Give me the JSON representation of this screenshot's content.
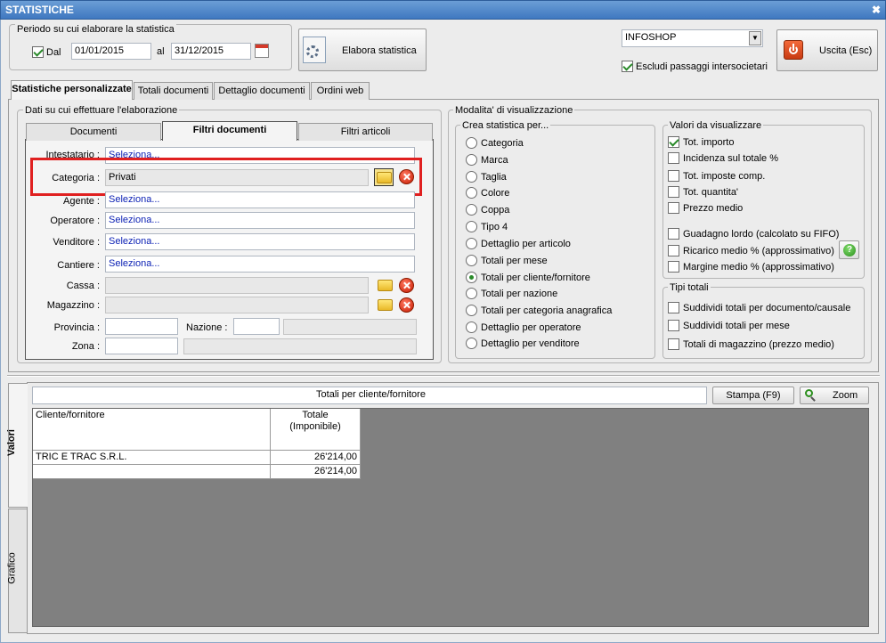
{
  "window": {
    "title": "STATISTICHE",
    "close_glyph": "✖"
  },
  "period": {
    "legend": "Periodo su cui elaborare la statistica",
    "from_checked": true,
    "from_label": "Dal",
    "from_value": "01/01/2015",
    "to_label": "al",
    "to_value": "31/12/2015",
    "calendar_icon": "calendar-icon"
  },
  "elabora_button": {
    "label": "Elabora statistica",
    "icon": "gear-document-icon"
  },
  "company_select": {
    "value": "INFOSHOP"
  },
  "escludi": {
    "checked": true,
    "label": "Escludi passaggi intersocietari"
  },
  "exit_button": {
    "label": "Uscita (Esc)",
    "icon": "power-icon"
  },
  "main_tabs": [
    "Statistiche personalizzate",
    "Totali documenti",
    "Dettaglio documenti",
    "Ordini web"
  ],
  "data_panel": {
    "legend": "Dati su cui effettuare l'elaborazione",
    "tabs": [
      "Documenti",
      "Filtri documenti",
      "Filtri articoli"
    ],
    "active_tab": "Filtri documenti",
    "fields": {
      "intestatario": {
        "label": "Intestatario :",
        "value": "Seleziona..."
      },
      "categoria": {
        "label": "Categoria :",
        "value": "Privati"
      },
      "agente": {
        "label": "Agente :",
        "value": "Seleziona..."
      },
      "operatore": {
        "label": "Operatore :",
        "value": "Seleziona..."
      },
      "venditore": {
        "label": "Venditore :",
        "value": "Seleziona..."
      },
      "cantiere": {
        "label": "Cantiere :",
        "value": "Seleziona..."
      },
      "cassa": {
        "label": "Cassa :",
        "value": ""
      },
      "magazzino": {
        "label": "Magazzino :",
        "value": ""
      },
      "provincia": {
        "label": "Provincia :",
        "value": ""
      },
      "nazione": {
        "label": "Nazione :",
        "value": ""
      },
      "zona": {
        "label": "Zona :",
        "value": ""
      }
    },
    "highlight_color": "#e02020"
  },
  "modalita": {
    "legend": "Modalita' di visualizzazione",
    "crea": {
      "legend": "Crea statistica per...",
      "options": [
        "Categoria",
        "Marca",
        "Taglia",
        "Colore",
        "Coppa",
        "Tipo 4",
        "Dettaglio per articolo",
        "Totali per mese",
        "Totali per cliente/fornitore",
        "Totali per nazione",
        "Totali per categoria anagrafica",
        "Dettaglio per operatore",
        "Dettaglio per venditore"
      ],
      "selected": "Totali per cliente/fornitore"
    },
    "valori": {
      "legend": "Valori da visualizzare",
      "options": [
        {
          "label": "Tot. importo",
          "checked": true
        },
        {
          "label": "Incidenza sul totale %",
          "checked": false
        },
        {
          "label": "Tot. imposte comp.",
          "checked": false
        },
        {
          "label": "Tot. quantita'",
          "checked": false
        },
        {
          "label": "Prezzo medio",
          "checked": false
        },
        {
          "label": "Guadagno lordo (calcolato su FIFO)",
          "checked": false
        },
        {
          "label": "Ricarico medio % (approssimativo)",
          "checked": false
        },
        {
          "label": "Margine medio % (approssimativo)",
          "checked": false
        }
      ],
      "help_icon": "help-icon"
    },
    "tipi": {
      "legend": "Tipi totali",
      "options": [
        {
          "label": "Suddividi totali per documento/causale",
          "checked": false
        },
        {
          "label": "Suddividi totali per mese",
          "checked": false
        },
        {
          "label": "Totali di magazzino (prezzo medio)",
          "checked": false
        }
      ]
    }
  },
  "results": {
    "side_tabs": [
      "Valori",
      "Grafico"
    ],
    "active_side_tab": "Valori",
    "title": "Totali per cliente/fornitore",
    "print_button": "Stampa (F9)",
    "zoom_button": "Zoom",
    "columns": [
      "Cliente/fornitore",
      "Totale\n(Imponibile)"
    ],
    "rows": [
      {
        "cliente": "TRIC E TRAC S.R.L.",
        "totale": "26'214,00"
      },
      {
        "cliente": "",
        "totale": "26'214,00"
      }
    ]
  }
}
